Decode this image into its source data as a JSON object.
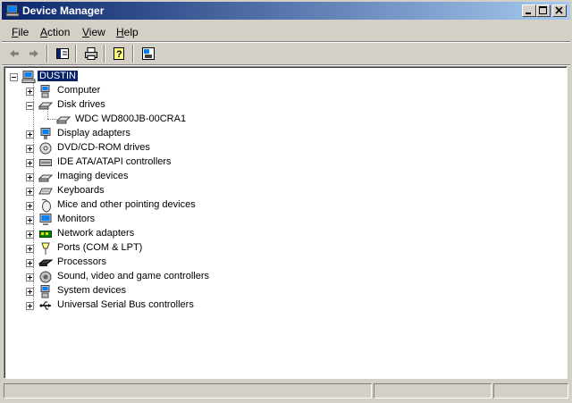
{
  "window": {
    "title": "Device Manager",
    "controls": {
      "minimize": "minimize-icon",
      "maximize": "maximize-icon",
      "close": "close-icon"
    }
  },
  "menu": [
    {
      "label": "File",
      "accel": "F",
      "rest": "ile"
    },
    {
      "label": "Action",
      "accel": "A",
      "rest": "ction"
    },
    {
      "label": "View",
      "accel": "V",
      "rest": "iew"
    },
    {
      "label": "Help",
      "accel": "H",
      "rest": "elp"
    }
  ],
  "toolbar": [
    "back-arrow-icon",
    "forward-arrow-icon",
    "show-hide-tree-icon",
    "print-icon",
    "help-icon",
    "properties-icon"
  ],
  "tree": {
    "root": "DUSTIN",
    "categories": [
      {
        "label": "Computer",
        "icon": "computer-icon",
        "expanded": false
      },
      {
        "label": "Disk drives",
        "icon": "disk-drive-icon",
        "expanded": true,
        "children": [
          "WDC WD800JB-00CRA1"
        ]
      },
      {
        "label": "Display adapters",
        "icon": "display-adapter-icon",
        "expanded": false
      },
      {
        "label": "DVD/CD-ROM drives",
        "icon": "cdrom-icon",
        "expanded": false
      },
      {
        "label": "IDE ATA/ATAPI controllers",
        "icon": "ide-controller-icon",
        "expanded": false
      },
      {
        "label": "Imaging devices",
        "icon": "imaging-device-icon",
        "expanded": false
      },
      {
        "label": "Keyboards",
        "icon": "keyboard-icon",
        "expanded": false
      },
      {
        "label": "Mice and other pointing devices",
        "icon": "mouse-icon",
        "expanded": false
      },
      {
        "label": "Monitors",
        "icon": "monitor-icon",
        "expanded": false
      },
      {
        "label": "Network adapters",
        "icon": "network-adapter-icon",
        "expanded": false
      },
      {
        "label": "Ports (COM & LPT)",
        "icon": "port-icon",
        "expanded": false
      },
      {
        "label": "Processors",
        "icon": "processor-icon",
        "expanded": false
      },
      {
        "label": "Sound, video and game controllers",
        "icon": "sound-icon",
        "expanded": false
      },
      {
        "label": "System devices",
        "icon": "system-device-icon",
        "expanded": false
      },
      {
        "label": "Universal Serial Bus controllers",
        "icon": "usb-icon",
        "expanded": false
      }
    ]
  },
  "colors": {
    "titlebar_start": "#0a246a",
    "titlebar_end": "#a6caf0",
    "face": "#d4d0c8",
    "selection": "#0a246a"
  }
}
